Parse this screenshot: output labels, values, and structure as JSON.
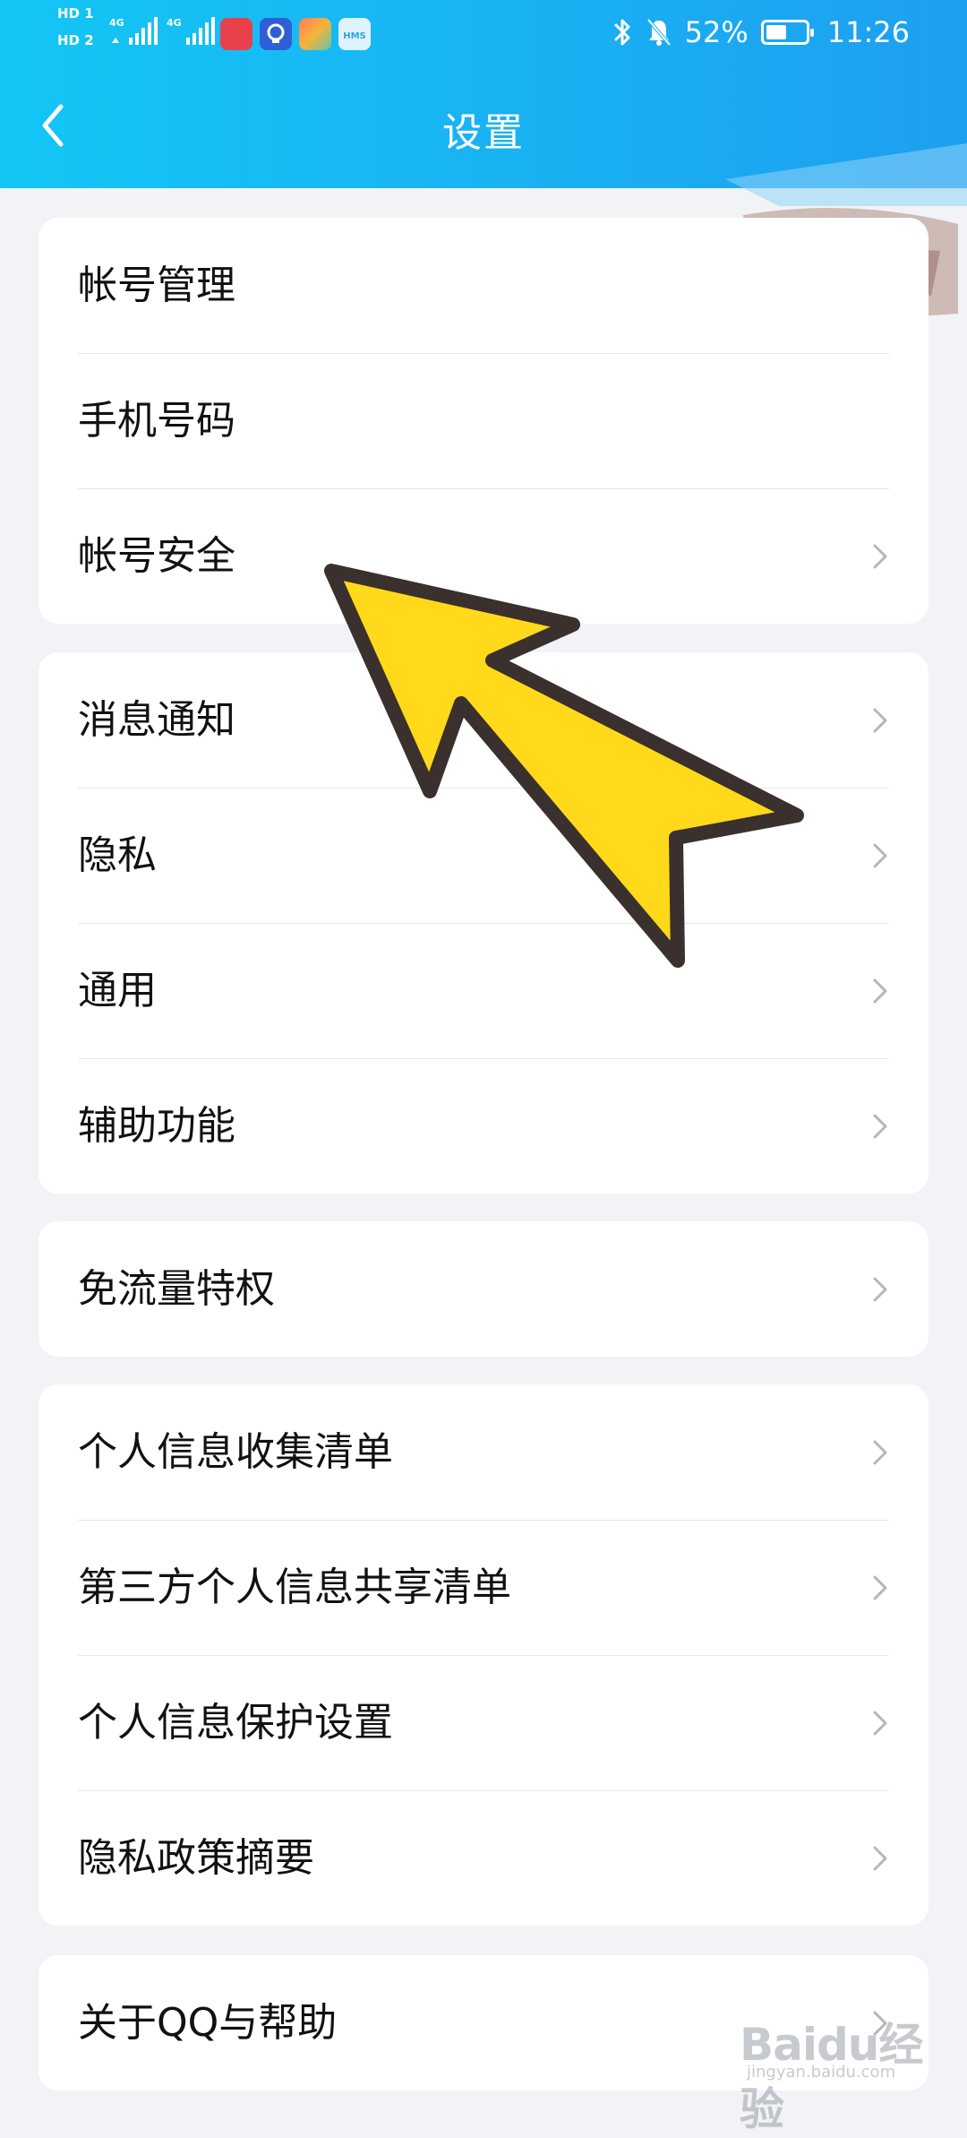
{
  "status_bar": {
    "sim1": "HD 1",
    "sim2": "HD 2",
    "network1": "4G",
    "network2": "4G",
    "app_icons": [
      {
        "name": "huawei-app-icon",
        "color": "#e8414b"
      },
      {
        "name": "bulb-app-icon",
        "color": "#2f5fd6"
      },
      {
        "name": "colorful-app-icon",
        "color": "#f4b43c"
      },
      {
        "name": "hms-app-icon",
        "color": "#dff3ff"
      }
    ],
    "hms_label": "HMS",
    "battery_text": "52%",
    "battery_level": 0.52,
    "time": "11:26"
  },
  "header": {
    "title": "设置"
  },
  "groups": [
    {
      "items": [
        {
          "label": "帐号管理",
          "chevron": false
        },
        {
          "label": "手机号码",
          "chevron": false
        },
        {
          "label": "帐号安全",
          "chevron": true
        }
      ]
    },
    {
      "items": [
        {
          "label": "消息通知",
          "chevron": true
        },
        {
          "label": "隐私",
          "chevron": true
        },
        {
          "label": "通用",
          "chevron": true
        },
        {
          "label": "辅助功能",
          "chevron": true
        }
      ]
    },
    {
      "items": [
        {
          "label": "免流量特权",
          "chevron": true
        }
      ]
    },
    {
      "items": [
        {
          "label": "个人信息收集清单",
          "chevron": true
        },
        {
          "label": "第三方个人信息共享清单",
          "chevron": true
        },
        {
          "label": "个人信息保护设置",
          "chevron": true
        },
        {
          "label": "隐私政策摘要",
          "chevron": true
        }
      ]
    },
    {
      "items": [
        {
          "label": "关于QQ与帮助",
          "chevron": true
        }
      ]
    }
  ],
  "watermark": {
    "brand": "Baidu经验",
    "url": "jingyan.baidu.com"
  },
  "colors": {
    "header_start": "#12c6f5",
    "header_end": "#1d9ff0",
    "arrow_fill": "#ffd91a",
    "arrow_stroke": "#3a302d"
  }
}
